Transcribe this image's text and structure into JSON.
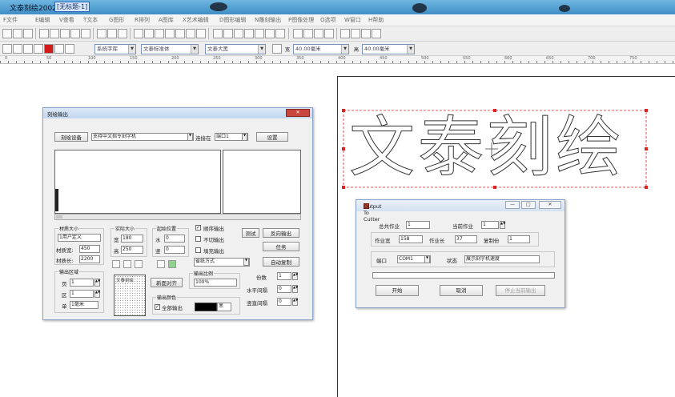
{
  "window": {
    "title": "文泰刻绘2002 -",
    "doc_tab": "[无标题-1]"
  },
  "menu": [
    "F文件",
    "E编辑",
    "V查看",
    "T文本",
    "G图形",
    "R排列",
    "A图库",
    "X艺术编辑",
    "D图形编辑",
    "N雕刻输出",
    "P图像处理",
    "O选项",
    "W窗口",
    "H帮助"
  ],
  "toolbar2": {
    "font_combo": "系统字库",
    "font_name": "文泰标准体",
    "style": "文泰大黑",
    "size1": "40.00毫米",
    "size2": "40.00毫米"
  },
  "ruler_numbers": [
    "0",
    "50",
    "100",
    "150",
    "200",
    "250",
    "300",
    "350",
    "400",
    "450",
    "500",
    "550",
    "600",
    "650",
    "700",
    "750"
  ],
  "canvas_text": "文泰刻绘",
  "engrave_dialog": {
    "title": "刻绘输出",
    "device_button": "刻绘设备",
    "device_value": "支持中文指令刻字机",
    "port_label": "连接在",
    "port_value": "端口1",
    "settings_button": "设置",
    "material_group": "材质大小",
    "material_user": "1用户定义",
    "material_width_label": "材质宽:",
    "material_width": "450",
    "material_length_label": "材质长:",
    "material_length": "2200",
    "actual_group": "实际大小",
    "actual_width_label": "宽",
    "actual_width": "180",
    "actual_height_label": "高",
    "actual_height": "250",
    "origin_group": "起始位置",
    "origin_h_label": "水",
    "origin_h": "0",
    "origin_v_label": "竖",
    "origin_v": "0",
    "opt_output_order": "顺序输出",
    "opt_single_copy": "不切输出",
    "opt_fill_output": "填充输出",
    "test_button": "测试",
    "mirror_output": "反向输出",
    "task_button": "任务",
    "mode_select": "省纸方式",
    "auto_copy": "自动复制",
    "output_area_group": "输出区域",
    "area_page_label": "页",
    "area_page": "1",
    "area_zone_label": "区",
    "area_zone": "1",
    "area_unit_label": "单",
    "area_unit": "1毫米",
    "preview_label": "文泰刻绘",
    "new_page_button": "新面对齐",
    "scale_group": "输出比例",
    "scale_value": "100%",
    "color_group": "输出颜色",
    "all_output": "全部输出",
    "color_value": "黑",
    "copies_label": "份数",
    "copies": "1",
    "h_spacing_label": "水平间隔",
    "h_spacing": "0",
    "v_spacing_label": "竖直间隔",
    "v_spacing": "0"
  },
  "cutter_dialog": {
    "title": "Output To Cutter",
    "total_jobs_label": "总共作业",
    "total_jobs": "1",
    "current_job_label": "当前作业",
    "current_job": "1",
    "job_width_label": "作业宽",
    "job_width": "158",
    "job_length_label": "作业长",
    "job_length": "37",
    "copies_label": "复制份",
    "copies": "1",
    "port_label": "端口",
    "port_value": "COM1",
    "status_label": "状态",
    "status_value": "展示刻字机速度",
    "start_button": "开始",
    "cancel_button": "取消",
    "stop_button": "停止当前输出"
  }
}
